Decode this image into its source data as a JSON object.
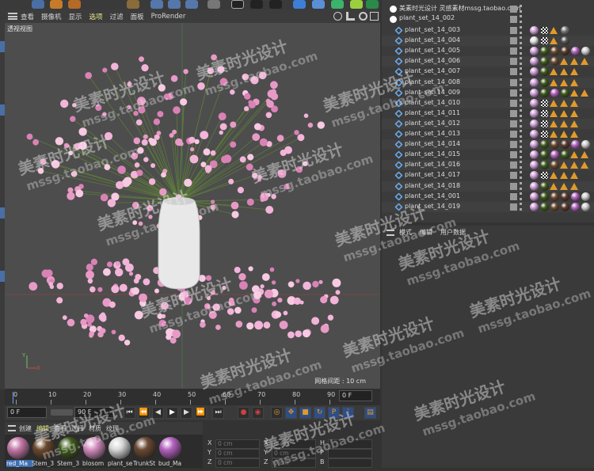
{
  "viewport": {
    "menu": [
      "查看",
      "摄像机",
      "显示",
      "选项",
      "过滤",
      "面板",
      "ProRender"
    ],
    "active_menu_index": 3,
    "label": "透视视图",
    "grid_spacing": "网格间距 : 10 cm",
    "axis_labels": {
      "y": "Y",
      "x": "X"
    }
  },
  "timeline": {
    "ticks": [
      "0",
      "10",
      "20",
      "30",
      "40",
      "50",
      "60",
      "70",
      "80",
      "90"
    ],
    "end_frame": "0 F"
  },
  "transport": {
    "start": "0 F",
    "end": "90 F"
  },
  "materials": {
    "menu": [
      "创建",
      "编辑",
      "查看",
      "选择",
      "材质",
      "纹理"
    ],
    "active_menu_index": 1,
    "items": [
      {
        "label": "red_Ma",
        "color": "#c47aa8"
      },
      {
        "label": "Stem_3",
        "color": "#6b4a2e"
      },
      {
        "label": "Stem_3",
        "color": "#3f5a1c"
      },
      {
        "label": "blosom",
        "color": "#d58fc0"
      },
      {
        "label": "plant_se",
        "color": "#d8d8d8"
      },
      {
        "label": "TrunkSt",
        "color": "#6a4a33"
      },
      {
        "label": "bud_Ma",
        "color": "#b564c0"
      }
    ]
  },
  "coords": {
    "rows": [
      {
        "a": "X",
        "av": "0 cm",
        "b": "X",
        "bv": "0 cm",
        "c": "H"
      },
      {
        "a": "Y",
        "av": "0 cm",
        "b": "Y",
        "bv": "0 cm",
        "c": "P"
      },
      {
        "a": "Z",
        "av": "0 cm",
        "b": "Z",
        "bv": "0 cm",
        "c": "B"
      }
    ]
  },
  "objects": {
    "root": "美素时光设计 灵感素材mssg.taobao.com",
    "group": "plant_set_14_002",
    "children": [
      "plant_set_14_003",
      "plant_set_14_004",
      "plant_set_14_005",
      "plant_set_14_006",
      "plant_set_14_007",
      "plant_set_14_008",
      "plant_set_14_009",
      "plant_set_14_010",
      "plant_set_14_011",
      "plant_set_14_012",
      "plant_set_14_013",
      "plant_set_14_014",
      "plant_set_14_015",
      "plant_set_14_016",
      "plant_set_14_017",
      "plant_set_14_018",
      "plant_set_14_001",
      "plant_set_14_019"
    ]
  },
  "attributes": {
    "menu": [
      "模式",
      "编辑",
      "用户数据"
    ]
  },
  "watermark": {
    "cn": "美素时光设计",
    "en": "mssg.taobao.com"
  }
}
